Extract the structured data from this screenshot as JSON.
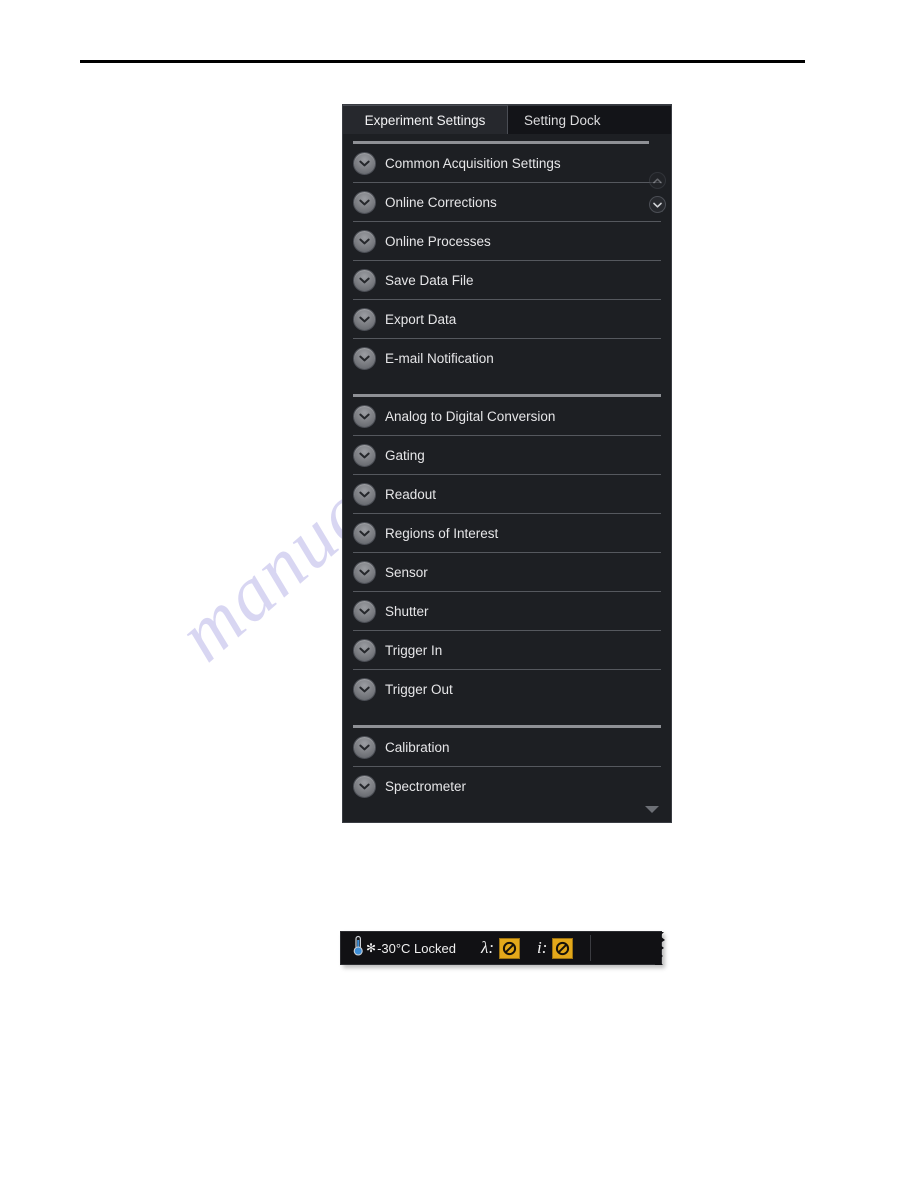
{
  "page": {
    "header_rule": "",
    "watermark_text": "manualsarchive.com"
  },
  "panel": {
    "tabs": [
      {
        "label": "Experiment Settings",
        "active": true
      },
      {
        "label": "Setting Dock",
        "active": false
      }
    ],
    "scroll_buttons": [
      {
        "name": "scroll-up-button",
        "icon": "chevron-up-icon",
        "state": "disabled"
      },
      {
        "name": "scroll-down-button",
        "icon": "chevron-down-icon",
        "state": "enabled"
      }
    ],
    "groups": [
      {
        "name": "acquisition-group",
        "items": [
          "Common Acquisition Settings",
          "Online Corrections",
          "Online Processes",
          "Save Data File",
          "Export Data",
          "E-mail Notification"
        ]
      },
      {
        "name": "hardware-group",
        "items": [
          "Analog to Digital Conversion",
          "Gating",
          "Readout",
          "Regions of Interest",
          "Sensor",
          "Shutter",
          "Trigger In",
          "Trigger Out"
        ]
      },
      {
        "name": "instrument-group",
        "items": [
          "Calibration",
          "Spectrometer"
        ]
      }
    ],
    "expander_icon": "chevron-down-circle-icon",
    "list_scroll_arrow_icon": "triangle-down-icon"
  },
  "status_bar": {
    "temperature": {
      "icon": "thermometer-icon",
      "snowflake": "✻",
      "text": "-30°C Locked"
    },
    "wavelength": {
      "symbol": "λ:",
      "icon": "no-entry-icon",
      "icon_color": "#e3a81a"
    },
    "intensity": {
      "symbol": "i:",
      "icon": "no-entry-icon",
      "icon_color": "#e3a81a"
    }
  }
}
